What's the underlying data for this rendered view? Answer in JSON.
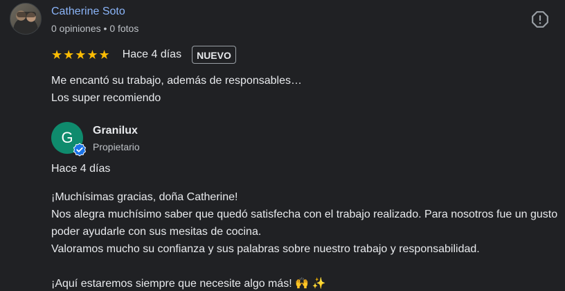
{
  "reviewer": {
    "name": "Catherine Soto",
    "reviews_count": "0 opiniones",
    "separator": "•",
    "photos_count": "0 fotos"
  },
  "review": {
    "stars": "★★★★★",
    "rating": 5,
    "date": "Hace 4 días",
    "badge": "NUEVO",
    "text_line1": "Me encantó su trabajo, además de responsables…",
    "text_line2": "Los super recomiendo"
  },
  "owner": {
    "initial": "G",
    "name": "Granilux",
    "role": "Propietario",
    "avatar_color": "#0f8b6d",
    "verified_icon": "verified-badge-icon"
  },
  "reply": {
    "date": "Hace 4 días",
    "line1": "¡Muchísimas gracias, doña Catherine!",
    "line2": "Nos alegra muchísimo saber que quedó satisfecha con el trabajo realizado. Para nosotros fue un gusto poder ayudarle con sus mesitas de cocina.",
    "line3": "Valoramos mucho su confianza y sus palabras sobre nuestro trabajo y responsabilidad.",
    "line4": "¡Aquí estaremos siempre que necesite algo más! 🙌 ✨"
  },
  "icons": {
    "report": "report-icon"
  },
  "colors": {
    "background": "#202124",
    "link": "#8ab4f8",
    "star": "#fbbc04",
    "verified": "#1a73e8"
  }
}
